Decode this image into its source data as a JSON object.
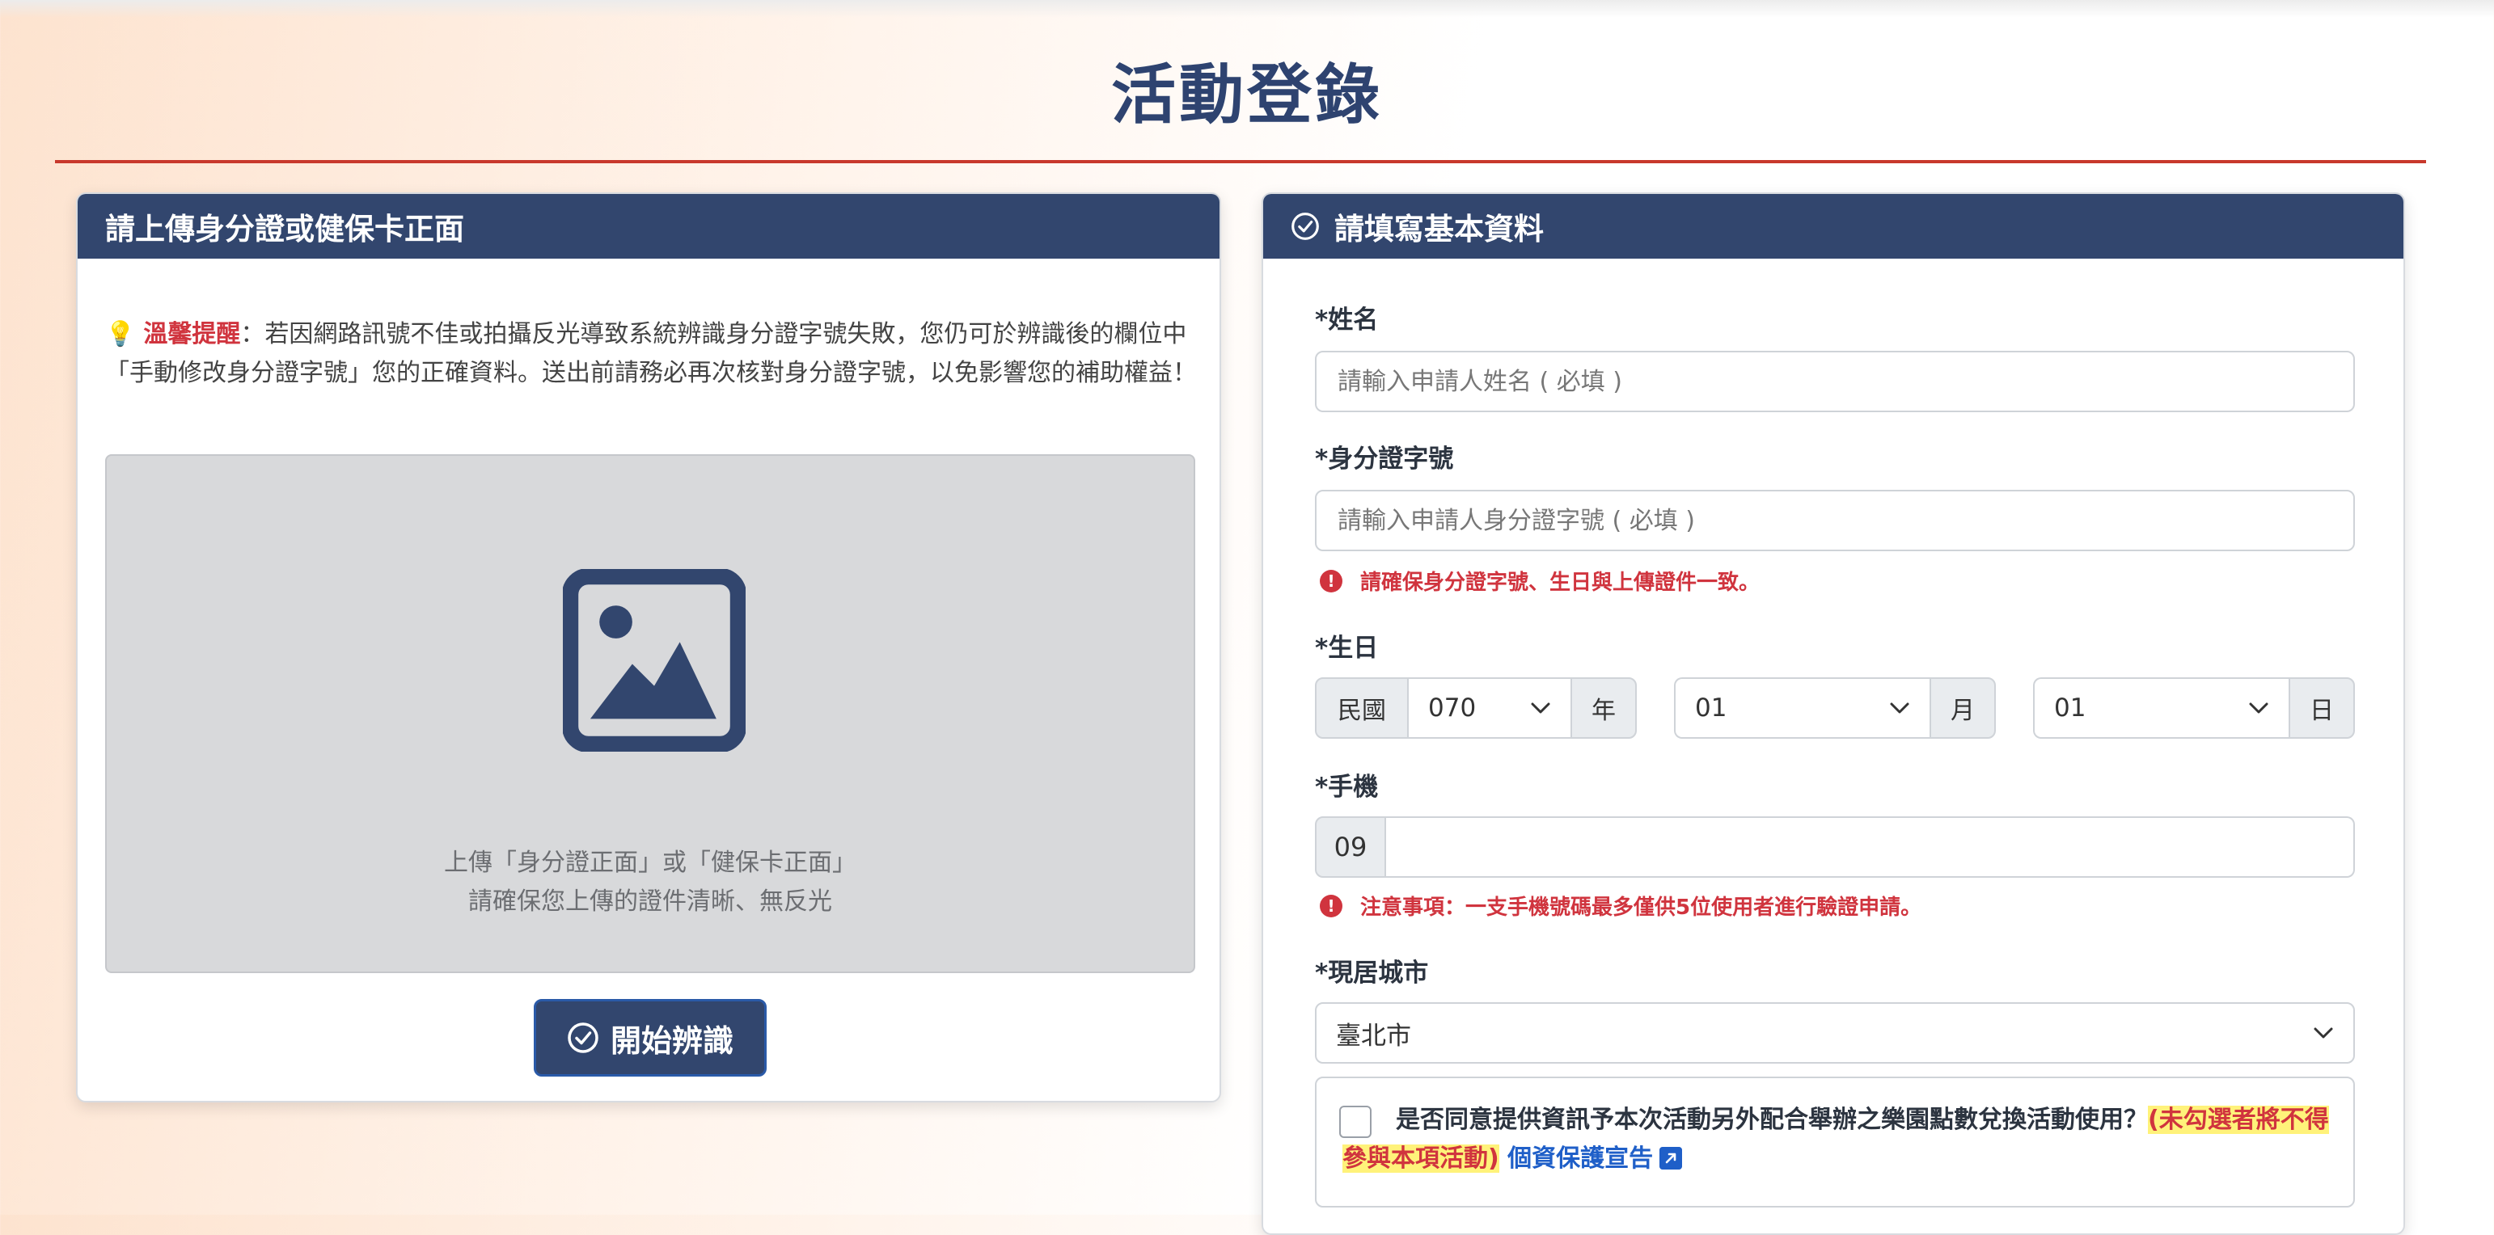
{
  "page": {
    "title": "活動登錄"
  },
  "upload_card": {
    "header": "請上傳身分證或健保卡正面",
    "notice_label": "溫馨提醒",
    "notice_text": "：若因網路訊號不佳或拍攝反光導致系統辨識身分證字號失敗，您仍可於辨識後的欄位中「手動修改身分證字號」您的正確資料。送出前請務必再次核對身分證字號，以免影響您的補助權益！",
    "upload_line1": "上傳「身分證正面」或「健保卡正面」",
    "upload_line2": "請確保您上傳的證件清晰、無反光",
    "start_button": "開始辨識"
  },
  "form_card": {
    "header": "請填寫基本資料",
    "name": {
      "label": "*姓名",
      "placeholder": "請輸入申請人姓名 ( 必填 )",
      "value": ""
    },
    "id": {
      "label": "*身分證字號",
      "placeholder": "請輸入申請人身分證字號 ( 必填 )",
      "value": "",
      "hint": "請確保身分證字號、生日與上傳證件一致。"
    },
    "birthday": {
      "label": "*生日",
      "era": "民國",
      "year": "070",
      "year_unit": "年",
      "month": "01",
      "month_unit": "月",
      "day": "01",
      "day_unit": "日"
    },
    "phone": {
      "label": "*手機",
      "prefix": "09",
      "value": "",
      "hint": "注意事項：一支手機號碼最多僅供5位使用者進行驗證申請。"
    },
    "city": {
      "label": "*現居城市",
      "value": "臺北市"
    },
    "consent": {
      "text": "是否同意提供資訊予本次活動另外配合舉辦之樂園點數兌換活動使用？",
      "warning": "(未勾選者將不得參與本項活動)",
      "link": "個資保護宣告",
      "checked": false
    }
  },
  "colors": {
    "primary": "#32466e",
    "accent_red": "#d0343e",
    "rule": "#c8382c",
    "link": "#1f5fc8",
    "highlight": "#fff27a"
  }
}
